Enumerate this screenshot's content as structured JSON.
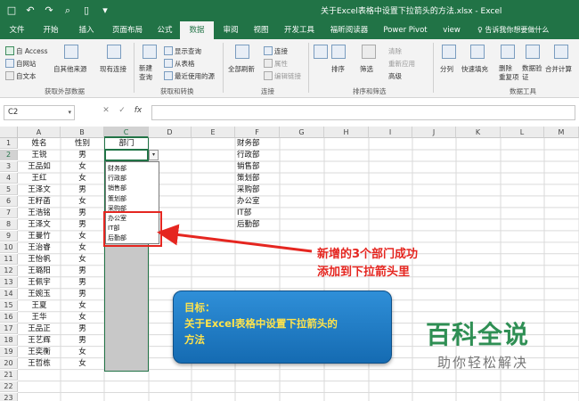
{
  "window": {
    "title": "关于Excel表格中设置下拉箭头的方法.xlsx  -  Excel",
    "qat": [
      "□",
      "↶",
      "↷",
      "⌕",
      "▯",
      "▾"
    ]
  },
  "ribbon_tabs": [
    "文件",
    "开始",
    "插入",
    "页面布局",
    "公式",
    "数据",
    "审阅",
    "视图",
    "开发工具",
    "福昕阅读器",
    "Power Pivot",
    "view"
  ],
  "tell_me": "♀ 告诉我你想要做什么",
  "ribbon": {
    "get_external": {
      "access": "自 Access",
      "web": "自网站",
      "text": "自文本",
      "other": "自其他来源",
      "existing": "现有连接",
      "title": "获取外部数据"
    },
    "transform": {
      "new_query": "新建\n查询",
      "show_queries": "显示查询",
      "from_table": "从表格",
      "recent": "最近使用的源",
      "title": "获取和转换"
    },
    "connections": {
      "refresh": "全部刷新",
      "connections": "连接",
      "properties": "属性",
      "edit_links": "编辑链接",
      "title": "连接"
    },
    "sort": {
      "sort": "排序",
      "filter": "筛选",
      "clear": "清除",
      "reapply": "重新应用",
      "advanced": "高级",
      "title": "排序和筛选"
    },
    "tools": {
      "split": "分列",
      "flash": "快速填充",
      "remove_dup": "删除\n重复项",
      "validation": "数据验\n证",
      "consolidate": "合并计算",
      "title": "数据工具"
    }
  },
  "formula_bar": {
    "name_box": "C2",
    "cancel": "✕",
    "enter": "✓",
    "fx": "fx",
    "value": ""
  },
  "columns": [
    "A",
    "B",
    "C",
    "D",
    "E",
    "F",
    "G",
    "H",
    "I",
    "J",
    "K",
    "L",
    "M"
  ],
  "rows": [
    "1",
    "2",
    "3",
    "4",
    "5",
    "6",
    "7",
    "8",
    "9",
    "10",
    "11",
    "12",
    "13",
    "14",
    "15",
    "16",
    "17",
    "18",
    "19",
    "20",
    "21",
    "22",
    "23"
  ],
  "sheet": {
    "col_A": [
      "姓名",
      "王锐",
      "王品如",
      "王红",
      "王泽文",
      "王籽菡",
      "王浩铭",
      "王泽文",
      "王曼竹",
      "王治睿",
      "王怡帆",
      "王璐阳",
      "王佩宇",
      "王婉玉",
      "王夏",
      "王华",
      "王品正",
      "王艺辉",
      "王奕衡",
      "王哲栋"
    ],
    "col_B": [
      "性别",
      "男",
      "女",
      "女",
      "男",
      "女",
      "男",
      "男",
      "女",
      "女",
      "女",
      "男",
      "男",
      "男",
      "女",
      "女",
      "男",
      "男",
      "女",
      "女"
    ],
    "col_C_header": "部门",
    "col_F": [
      "财务部",
      "行政部",
      "销售部",
      "策划部",
      "采购部",
      "办公室",
      "IT部",
      "后勤部"
    ]
  },
  "dropdown": {
    "items": [
      "财务部",
      "行政部",
      "销售部",
      "策划部",
      "采购部",
      "办公室",
      "IT部",
      "后勤部"
    ],
    "arrow": "▾"
  },
  "annotation": {
    "line1": "新增的3个部门成功",
    "line2": "添加到下拉箭头里"
  },
  "goal": {
    "line1": "目标：",
    "line2": "关于Excel表格中设置下拉箭头的",
    "line3": "方法"
  },
  "watermark": {
    "big": "百科全说",
    "small": "助你轻松解决"
  },
  "colors": {
    "excel_green": "#217346",
    "annotation_red": "#e52620",
    "goal_blue": "#1f7ec9",
    "goal_text": "#ffe34c",
    "watermark_green": "#2f8f54"
  }
}
